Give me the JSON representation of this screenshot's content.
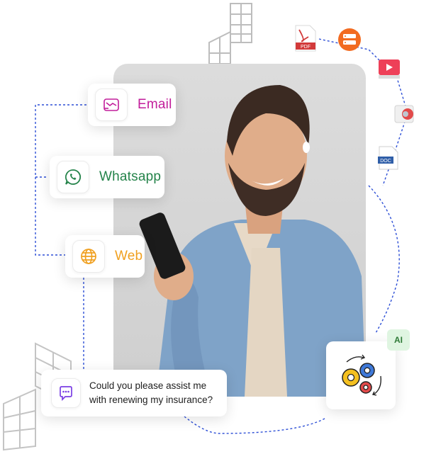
{
  "channels": {
    "email": {
      "label": "Email",
      "color": "#c21e9b",
      "icon": "email-icon"
    },
    "whatsapp": {
      "label": "Whatsapp",
      "color": "#24834a",
      "icon": "whatsapp-icon"
    },
    "web": {
      "label": "Web",
      "color": "#f0a020",
      "icon": "globe-icon"
    }
  },
  "chat": {
    "line1": "Could you please assist me",
    "line2": "with renewing my insurance?",
    "icon": "chat-bubble-icon",
    "accent": "#7b3fe4"
  },
  "ai": {
    "badge": "AI",
    "icon": "gears-icon"
  },
  "files": {
    "pdf_label": "PDF",
    "doc_label": "DOC"
  },
  "colors": {
    "connector": "#2d4fd6",
    "card_shadow": "rgba(0,0,0,0.12)"
  }
}
